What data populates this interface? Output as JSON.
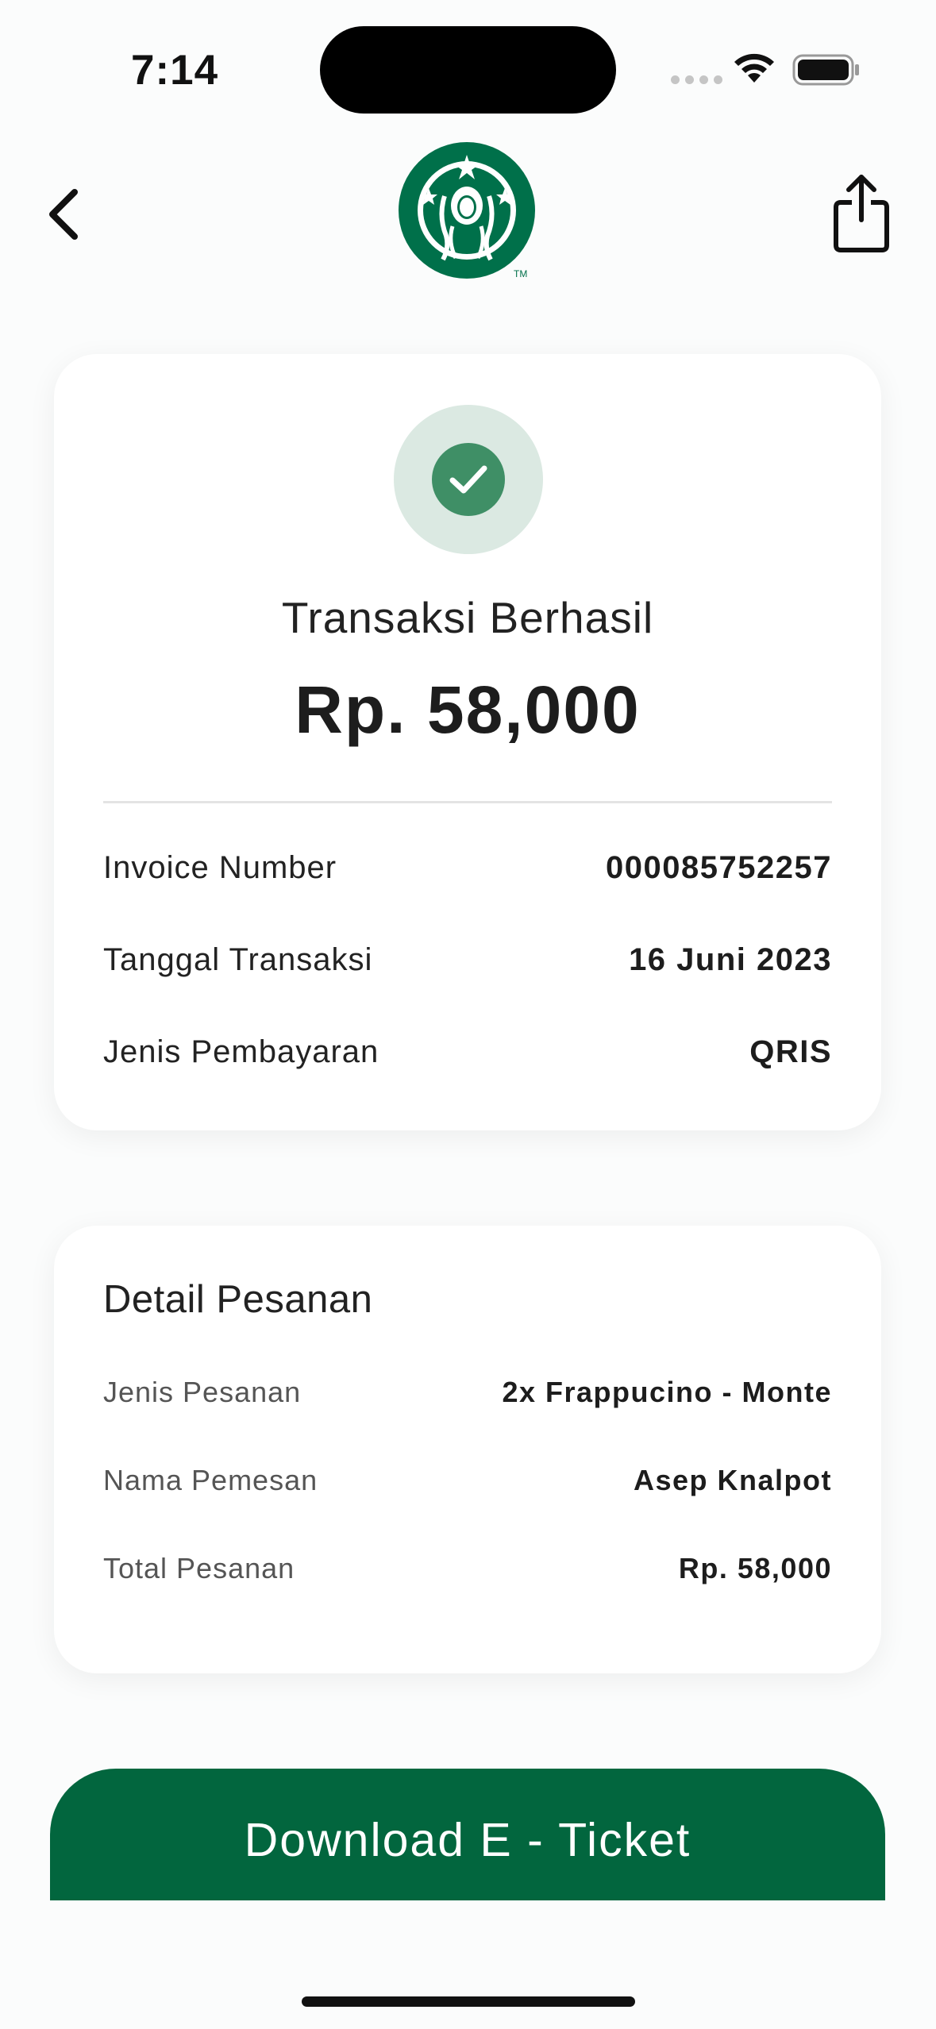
{
  "status_bar": {
    "time": "7:14"
  },
  "header": {
    "logo_name": "starbucks-logo"
  },
  "transaction": {
    "status_title": "Transaksi Berhasil",
    "amount": "Rp. 58,000",
    "rows": [
      {
        "label": "Invoice Number",
        "value": "000085752257"
      },
      {
        "label": "Tanggal Transaksi",
        "value": "16 Juni 2023"
      },
      {
        "label": "Jenis Pembayaran",
        "value": "QRIS"
      }
    ]
  },
  "order_detail": {
    "title": "Detail Pesanan",
    "rows": [
      {
        "label": "Jenis Pesanan",
        "value": "2x Frappucino - Monte"
      },
      {
        "label": "Nama Pemesan",
        "value": "Asep Knalpot"
      },
      {
        "label": "Total Pesanan",
        "value": "Rp. 58,000"
      }
    ]
  },
  "actions": {
    "download_label": "Download E - Ticket"
  },
  "colors": {
    "brand_green": "#02663e",
    "check_green": "#3f8f66",
    "check_bg": "#dbe9e2"
  }
}
